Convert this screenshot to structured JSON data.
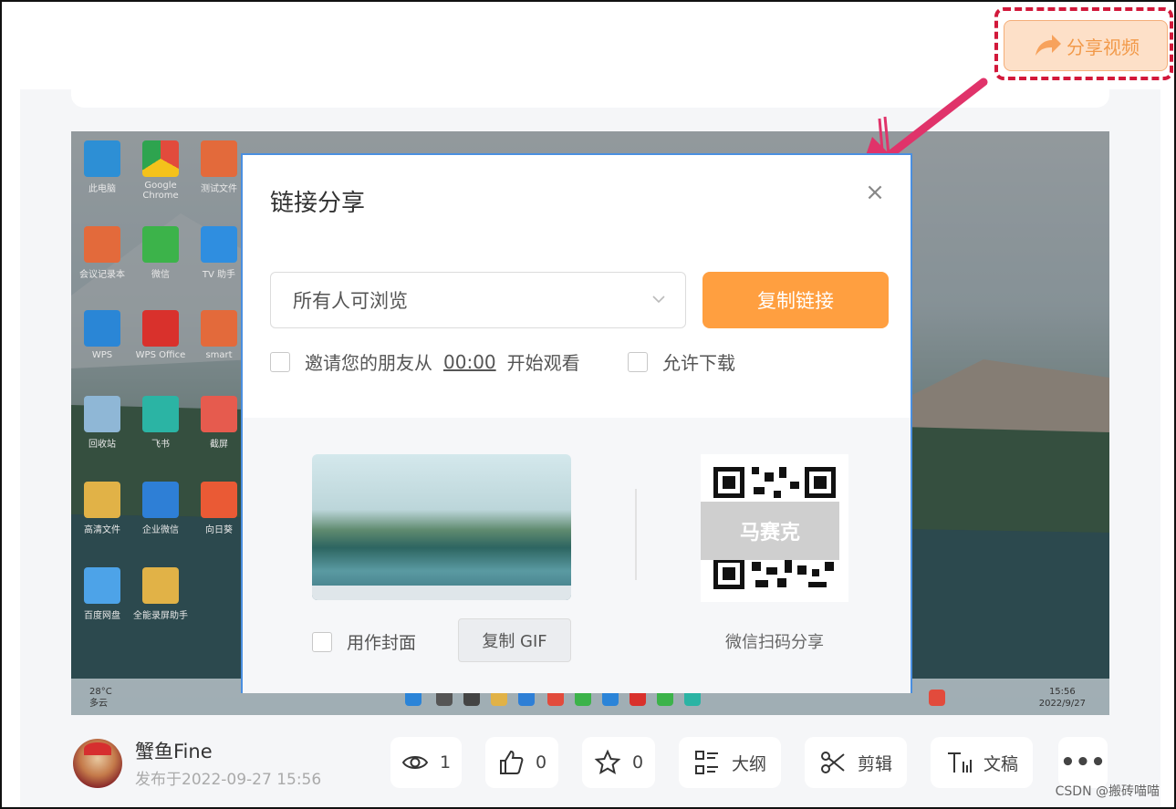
{
  "top": {
    "share_video_label": "分享视频"
  },
  "video": {
    "desktop_icons": [
      "此电脑",
      "Google Chrome",
      "测试文件",
      "会议记录本",
      "微信",
      "TV 助手",
      "WPS",
      "WPS Office",
      "smart",
      "回收站",
      "飞书",
      "截屏",
      "高清文件",
      "企业微信",
      "向日葵",
      "百度网盘",
      "全能录屏助手"
    ],
    "weather_temp": "28°C",
    "weather_desc": "多云",
    "time": "15:56",
    "date": "2022/9/27"
  },
  "modal": {
    "title": "链接分享",
    "close_icon": "close-icon",
    "visibility_select": "所有人可浏览",
    "copy_link_label": "复制链接",
    "invite_prefix": "邀请您的朋友从",
    "invite_time": "00:00",
    "invite_suffix": "开始观看",
    "allow_download_label": "允许下载",
    "use_as_cover_label": "用作封面",
    "copy_gif_label": "复制 GIF",
    "qr_overlay_label": "马赛克",
    "wechat_share_label": "微信扫码分享"
  },
  "author": {
    "name": "蟹鱼Fine",
    "published": "发布于2022-09-27 15:56"
  },
  "actions": {
    "views": "1",
    "likes": "0",
    "favorites": "0",
    "outline_label": "大纲",
    "edit_label": "剪辑",
    "transcript_label": "文稿"
  },
  "watermark": "CSDN @搬砖喵喵",
  "colors": {
    "accent_orange": "#ff9f40",
    "highlight_red": "#d2183a",
    "modal_border": "#4a8fe0"
  }
}
